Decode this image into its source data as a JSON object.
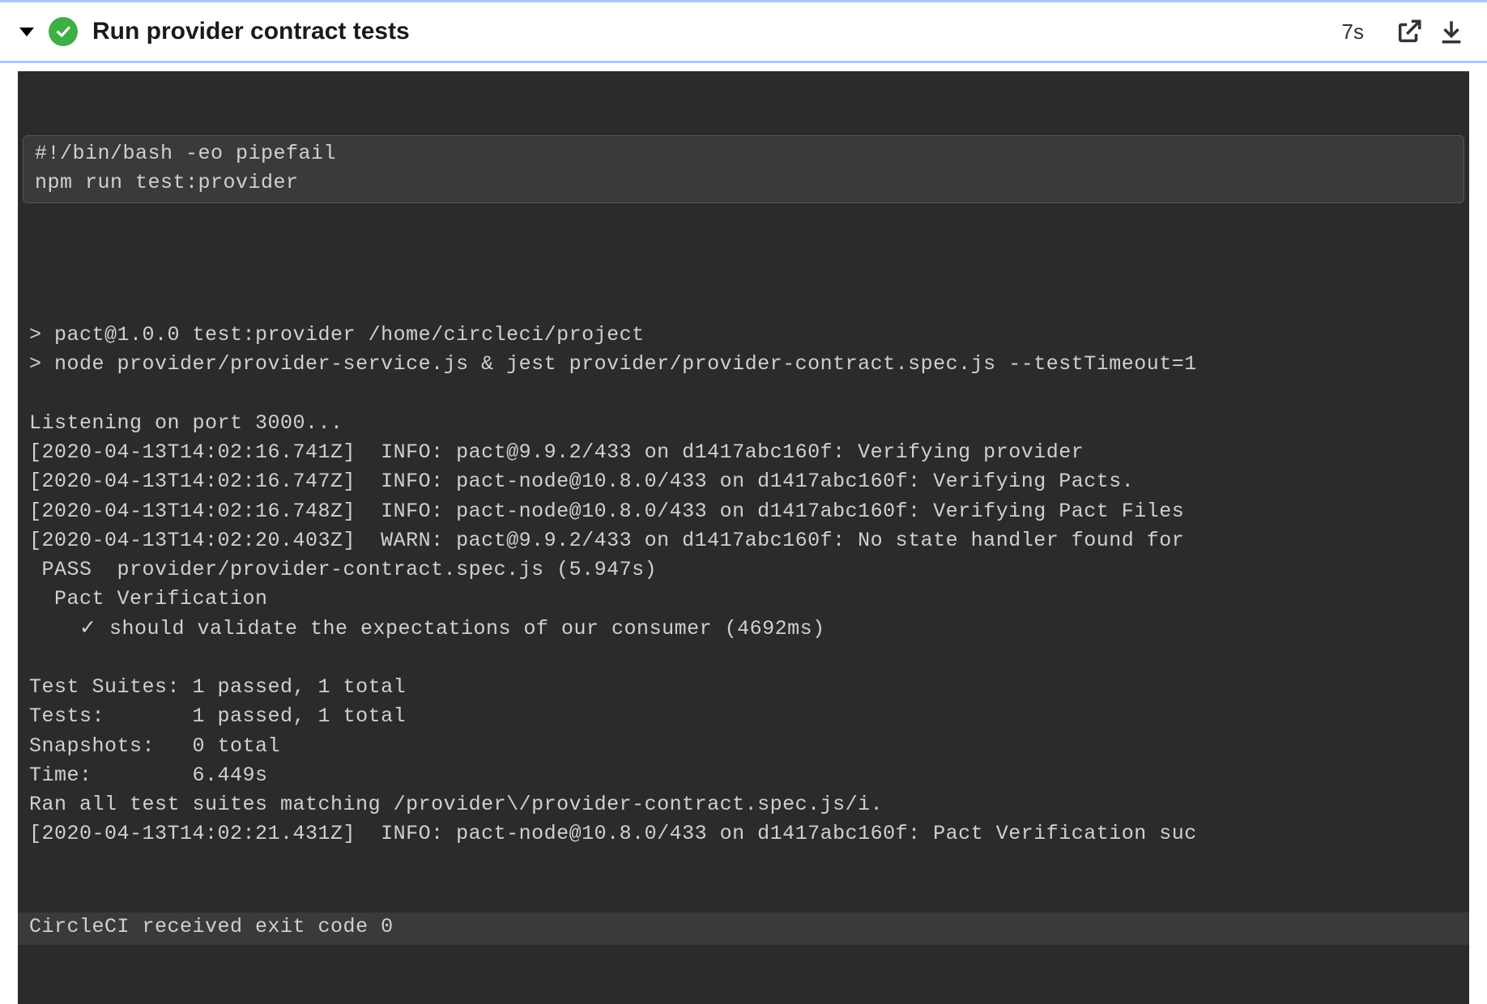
{
  "header": {
    "title": "Run provider contract tests",
    "duration": "7s"
  },
  "cmd": {
    "shebang": "#!/bin/bash -eo pipefail",
    "command": "npm run test:provider"
  },
  "output": {
    "blank1": " ",
    "blank2": " ",
    "npm1": "> pact@1.0.0 test:provider /home/circleci/project",
    "npm2": "> node provider/provider-service.js & jest provider/provider-contract.spec.js --testTimeout=1",
    "blank3": " ",
    "listen": "Listening on port 3000...",
    "log1": "[2020-04-13T14:02:16.741Z]  INFO: pact@9.9.2/433 on d1417abc160f: Verifying provider",
    "log2": "[2020-04-13T14:02:16.747Z]  INFO: pact-node@10.8.0/433 on d1417abc160f: Verifying Pacts.",
    "log3": "[2020-04-13T14:02:16.748Z]  INFO: pact-node@10.8.0/433 on d1417abc160f: Verifying Pact Files",
    "log4": "[2020-04-13T14:02:20.403Z]  WARN: pact@9.9.2/433 on d1417abc160f: No state handler found for",
    "pass": " PASS  provider/provider-contract.spec.js (5.947s)",
    "suite": "  Pact Verification",
    "test": "    ✓ should validate the expectations of our consumer (4692ms)",
    "blank4": " ",
    "summary1": "Test Suites: 1 passed, 1 total",
    "summary2": "Tests:       1 passed, 1 total",
    "summary3": "Snapshots:   0 total",
    "summary4": "Time:        6.449s",
    "ran": "Ran all test suites matching /provider\\/provider-contract.spec.js/i.",
    "log5": "[2020-04-13T14:02:21.431Z]  INFO: pact-node@10.8.0/433 on d1417abc160f: Pact Verification suc",
    "exit": "CircleCI received exit code 0"
  }
}
